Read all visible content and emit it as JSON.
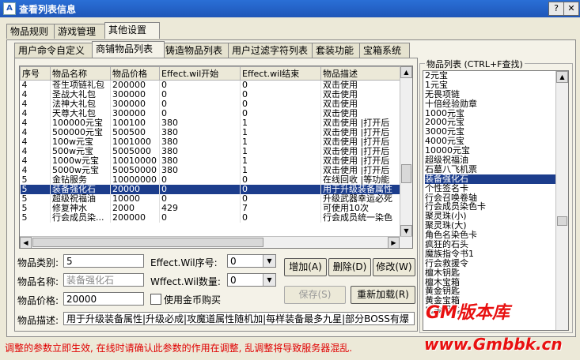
{
  "window": {
    "title": "查看列表信息",
    "app_icon": "app-icon"
  },
  "outer_tabs": [
    "物品规则",
    "游戏管理",
    "其他设置"
  ],
  "inner_tabs": [
    "用户命令自定义",
    "商铺物品列表",
    "铸造物品列表",
    "用户过滤字符列表",
    "套装功能",
    "宝箱系统"
  ],
  "grid": {
    "columns": [
      "序号",
      "物品名称",
      "物品价格",
      "Effect.wil开始",
      "Effect.wil结束",
      "物品描述"
    ],
    "rows": [
      [
        "4",
        "苍生项链礼包",
        "200000",
        "0",
        "0",
        "双击使用"
      ],
      [
        "4",
        "圣战大礼包",
        "300000",
        "0",
        "0",
        "双击使用"
      ],
      [
        "4",
        "法神大礼包",
        "300000",
        "0",
        "0",
        "双击使用"
      ],
      [
        "4",
        "天尊大礼包",
        "300000",
        "0",
        "0",
        "双击使用"
      ],
      [
        "4",
        "100000元宝",
        "100100",
        "380",
        "1",
        "双击使用 |打开后"
      ],
      [
        "4",
        "500000元宝",
        "500500",
        "380",
        "1",
        "双击使用 |打开后"
      ],
      [
        "4",
        "100w元宝",
        "1001000",
        "380",
        "1",
        "双击使用 |打开后"
      ],
      [
        "4",
        "500w元宝",
        "5005000",
        "380",
        "1",
        "双击使用 |打开后"
      ],
      [
        "4",
        "1000w元宝",
        "10010000",
        "380",
        "1",
        "双击使用 |打开后"
      ],
      [
        "4",
        "5000w元宝",
        "50050000",
        "380",
        "1",
        "双击使用 |打开后"
      ],
      [
        "5",
        "金钻服务",
        "10000000",
        "0",
        "0",
        "在线回收 |等功能"
      ],
      [
        "5",
        "装备强化石",
        "20000",
        "0",
        "0",
        "用于升级装备属性"
      ],
      [
        "5",
        "超级祝福油",
        "10000",
        "0",
        "0",
        "升级武器幸运必死"
      ],
      [
        "5",
        "修复神水",
        "2000",
        "429",
        "7",
        "可使用10次"
      ],
      [
        "5",
        "行会成员染...",
        "200000",
        "0",
        "0",
        "行会成员统一染色"
      ]
    ],
    "selected_row": 11
  },
  "form": {
    "category_label": "物品类别:",
    "category_value": "5",
    "name_label": "物品名称:",
    "name_value": "装备强化石",
    "price_label": "物品价格:",
    "price_value": "20000",
    "effect_index_label": "Effect.Wil序号:",
    "effect_index_value": "0",
    "effect_count_label": "Wffect.Wil数量:",
    "effect_count_value": "0",
    "use_gold_label": "使用金币购买",
    "desc_label": "物品描述:",
    "desc_value": "用于升级装备属性|升级必成|攻魔道属性随机加|每样装备最多九星|部分BOSS有爆"
  },
  "buttons": {
    "add": "增加(A)",
    "delete": "删除(D)",
    "edit": "修改(W)",
    "save": "保存(S)",
    "reload": "重新加载(R)"
  },
  "item_list": {
    "title": "物品列表 (CTRL+F查找)",
    "items": [
      "2元宝",
      "1元宝",
      "无畏项链",
      "十倍经验勋章",
      "1000元宝",
      "2000元宝",
      "3000元宝",
      "4000元宝",
      "10000元宝",
      "超级祝福油",
      "石墓八飞机票",
      "装备强化石",
      "个性签名卡",
      "行会召唤卷轴",
      "行会成员染色卡",
      "聚灵珠(小)",
      "聚灵珠(大)",
      "角色名染色卡",
      "疯狂的石头",
      "魔族指令书1",
      "行会救援令",
      "檀木钥匙",
      "檀木宝箱",
      "黄金钥匙",
      "黄金宝箱",
      "白金钥匙"
    ],
    "selected_index": 11
  },
  "warning": "调整的参数立即生效, 在线时请确认此参数的作用在调整, 乱调整将导致服务器混乱.",
  "watermark": {
    "top": "GM版本库",
    "bottom": "www.Gmbbk.cn"
  }
}
